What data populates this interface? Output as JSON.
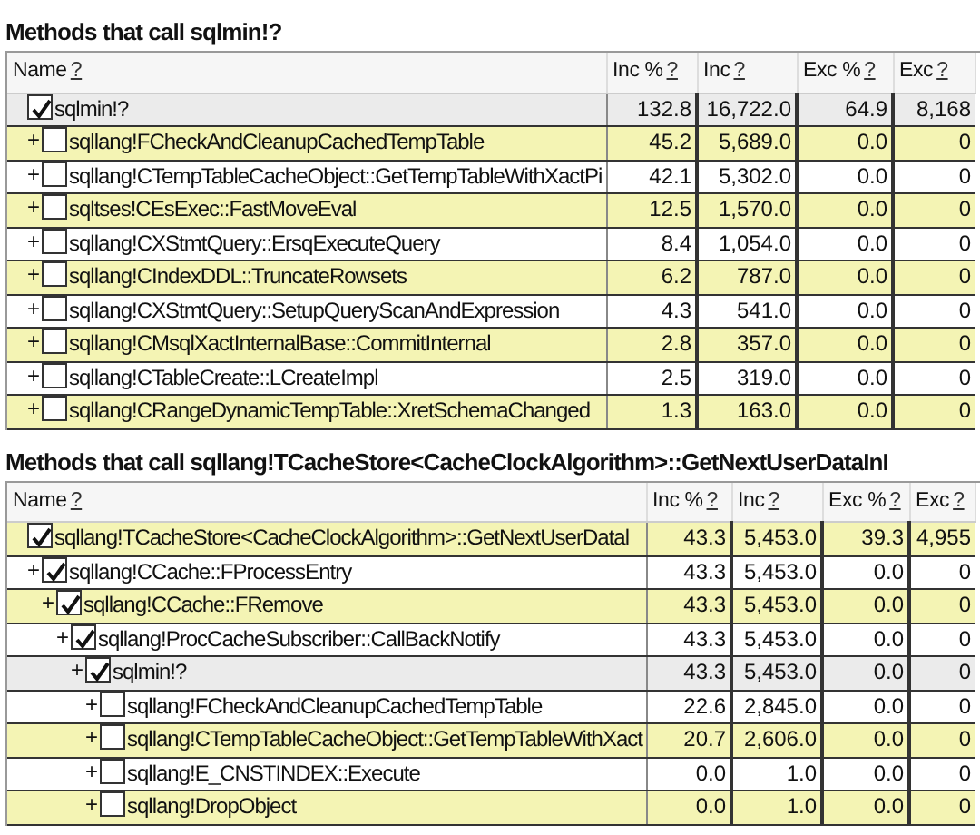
{
  "tables": [
    {
      "title": "Methods that call sqlmin!?",
      "columns": [
        {
          "label": "Name",
          "help": "?"
        },
        {
          "label": "Inc %",
          "help": "?"
        },
        {
          "label": "Inc",
          "help": "?"
        },
        {
          "label": "Exc %",
          "help": "?"
        },
        {
          "label": "Exc",
          "help": "?"
        }
      ],
      "rows": [
        {
          "name": "sqlmin!?",
          "toggle": "",
          "checked": true,
          "selected": true,
          "shaded": false,
          "values": [
            "132.8",
            "16,722.0",
            "64.9",
            "8,168"
          ],
          "children": [
            {
              "name": "sqllang!FCheckAndCleanupCachedTempTable",
              "toggle": "+",
              "checked": false,
              "selected": false,
              "shaded": true,
              "values": [
                "45.2",
                "5,689.0",
                "0.0",
                "0"
              ]
            },
            {
              "name": "sqllang!CTempTableCacheObject::GetTempTableWithXactPi",
              "toggle": "+",
              "checked": false,
              "selected": false,
              "shaded": false,
              "values": [
                "42.1",
                "5,302.0",
                "0.0",
                "0"
              ]
            },
            {
              "name": "sqltses!CEsExec::FastMoveEval",
              "toggle": "+",
              "checked": false,
              "selected": false,
              "shaded": true,
              "values": [
                "12.5",
                "1,570.0",
                "0.0",
                "0"
              ]
            },
            {
              "name": "sqllang!CXStmtQuery::ErsqExecuteQuery",
              "toggle": "+",
              "checked": false,
              "selected": false,
              "shaded": false,
              "values": [
                "8.4",
                "1,054.0",
                "0.0",
                "0"
              ]
            },
            {
              "name": "sqllang!CIndexDDL::TruncateRowsets",
              "toggle": "+",
              "checked": false,
              "selected": false,
              "shaded": true,
              "values": [
                "6.2",
                "787.0",
                "0.0",
                "0"
              ]
            },
            {
              "name": "sqllang!CXStmtQuery::SetupQueryScanAndExpression",
              "toggle": "+",
              "checked": false,
              "selected": false,
              "shaded": false,
              "values": [
                "4.3",
                "541.0",
                "0.0",
                "0"
              ]
            },
            {
              "name": "sqllang!CMsqlXactInternalBase::CommitInternal",
              "toggle": "+",
              "checked": false,
              "selected": false,
              "shaded": true,
              "values": [
                "2.8",
                "357.0",
                "0.0",
                "0"
              ]
            },
            {
              "name": "sqllang!CTableCreate::LCreateImpl",
              "toggle": "+",
              "checked": false,
              "selected": false,
              "shaded": false,
              "values": [
                "2.5",
                "319.0",
                "0.0",
                "0"
              ]
            },
            {
              "name": "sqllang!CRangeDynamicTempTable::XretSchemaChanged",
              "toggle": "+",
              "checked": false,
              "selected": false,
              "shaded": true,
              "values": [
                "1.3",
                "163.0",
                "0.0",
                "0"
              ]
            }
          ]
        }
      ]
    },
    {
      "title": "Methods that call sqllang!TCacheStore<CacheClockAlgorithm>::GetNextUserDataInI",
      "columns": [
        {
          "label": "Name",
          "help": "?"
        },
        {
          "label": "Inc %",
          "help": "?"
        },
        {
          "label": "Inc",
          "help": "?"
        },
        {
          "label": "Exc %",
          "help": "?"
        },
        {
          "label": "Exc",
          "help": "?"
        }
      ],
      "rows": [
        {
          "name": "sqllang!TCacheStore<CacheClockAlgorithm>::GetNextUserDatal",
          "toggle": "",
          "checked": true,
          "selected": false,
          "shaded": true,
          "values": [
            "43.3",
            "5,453.0",
            "39.3",
            "4,955"
          ],
          "children": [
            {
              "name": "sqllang!CCache::FProcessEntry",
              "toggle": "+",
              "checked": true,
              "selected": false,
              "shaded": false,
              "values": [
                "43.3",
                "5,453.0",
                "0.0",
                "0"
              ],
              "children": [
                {
                  "name": "sqllang!CCache::FRemove",
                  "toggle": "+",
                  "checked": true,
                  "selected": false,
                  "shaded": true,
                  "values": [
                    "43.3",
                    "5,453.0",
                    "0.0",
                    "0"
                  ],
                  "children": [
                    {
                      "name": "sqllang!ProcCacheSubscriber::CallBackNotify",
                      "toggle": "+",
                      "checked": true,
                      "selected": false,
                      "shaded": false,
                      "values": [
                        "43.3",
                        "5,453.0",
                        "0.0",
                        "0"
                      ],
                      "children": [
                        {
                          "name": "sqlmin!?",
                          "toggle": "+",
                          "checked": true,
                          "selected": true,
                          "shaded": false,
                          "values": [
                            "43.3",
                            "5,453.0",
                            "0.0",
                            "0"
                          ],
                          "children": [
                            {
                              "name": "sqllang!FCheckAndCleanupCachedTempTable",
                              "toggle": "+",
                              "checked": false,
                              "selected": false,
                              "shaded": false,
                              "values": [
                                "22.6",
                                "2,845.0",
                                "0.0",
                                "0"
                              ]
                            },
                            {
                              "name": "sqllang!CTempTableCacheObject::GetTempTableWithXact",
                              "toggle": "+",
                              "checked": false,
                              "selected": false,
                              "shaded": true,
                              "values": [
                                "20.7",
                                "2,606.0",
                                "0.0",
                                "0"
                              ]
                            },
                            {
                              "name": "sqllang!E_CNSTINDEX::Execute",
                              "toggle": "+",
                              "checked": false,
                              "selected": false,
                              "shaded": false,
                              "values": [
                                "0.0",
                                "1.0",
                                "0.0",
                                "0"
                              ]
                            },
                            {
                              "name": "sqllang!DropObject",
                              "toggle": "+",
                              "checked": false,
                              "selected": false,
                              "shaded": true,
                              "values": [
                                "0.0",
                                "1.0",
                                "0.0",
                                "0"
                              ]
                            }
                          ]
                        }
                      ]
                    }
                  ]
                }
              ]
            }
          ]
        }
      ]
    }
  ]
}
